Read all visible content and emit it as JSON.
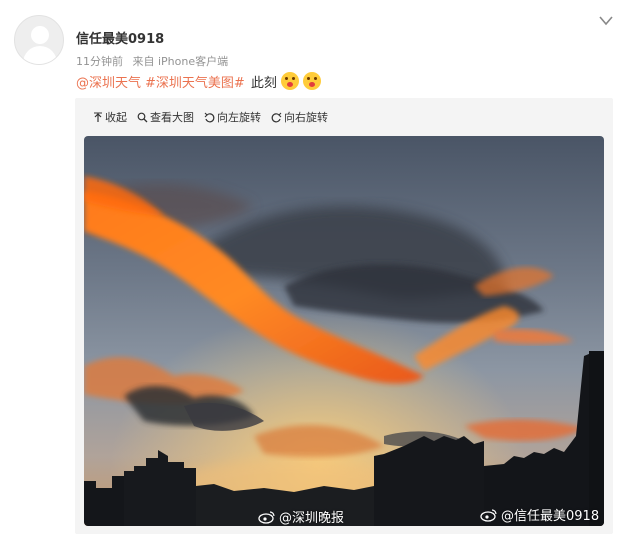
{
  "post": {
    "username": "信任最美0918",
    "time": "11分钟前",
    "source": "来自 iPhone客户端",
    "mention": "@深圳天气",
    "hashtag": "#深圳天气美图#",
    "text": "此刻"
  },
  "toolbar": {
    "collapse_label": "收起",
    "view_large_label": "查看大图",
    "rotate_left_label": "向左旋转",
    "rotate_right_label": "向右旋转"
  },
  "watermarks": {
    "left": "@深圳晚报",
    "right": "@信任最美0918"
  },
  "icons": {
    "more": "chevron-down-icon",
    "emoji": "emoji-icon",
    "collapse": "arrow-up-icon",
    "view_large": "magnifier-icon",
    "rotate_left": "rotate-left-icon",
    "rotate_right": "rotate-right-icon",
    "weibo": "weibo-logo-icon"
  },
  "colors": {
    "link": "#eb7350",
    "username": "#333333",
    "meta": "#939393",
    "media_bg": "#f4f4f4"
  }
}
